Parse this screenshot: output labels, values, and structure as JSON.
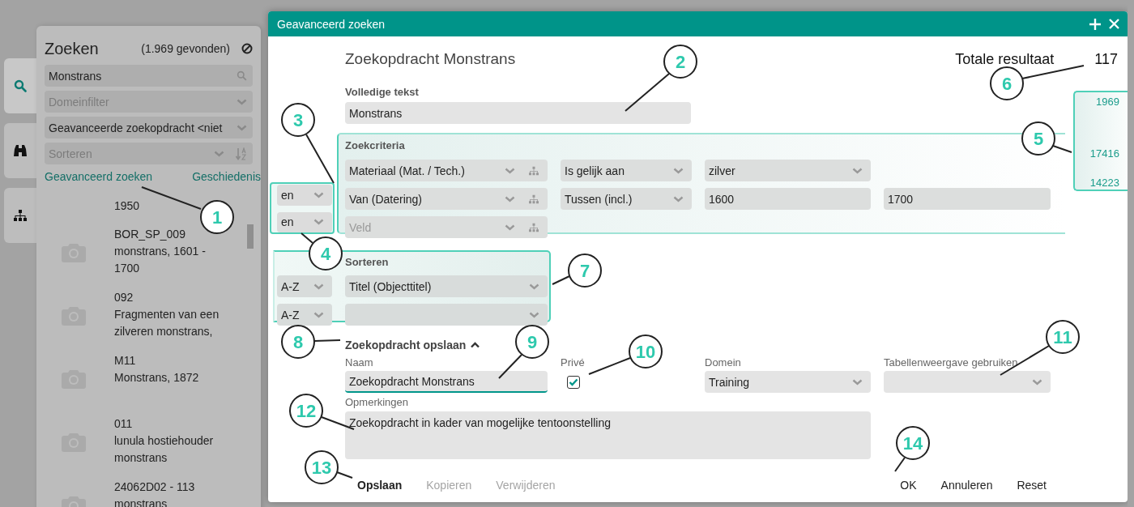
{
  "rail": [
    {
      "kind": "search",
      "selected": true
    },
    {
      "kind": "binoculars",
      "selected": false
    },
    {
      "kind": "hierarchy",
      "selected": false
    }
  ],
  "search_panel": {
    "title": "Zoeken",
    "count": "(1.969 gevonden)",
    "search": {
      "value": "Monstrans"
    },
    "domain_filter": {
      "placeholder": "Domeinfilter"
    },
    "saved_query": {
      "value": "Geavanceerde zoekopdracht <niet"
    },
    "sort": {
      "placeholder": "Sorteren"
    },
    "links": [
      "Geavanceerd zoeken",
      "Geschiedenis"
    ],
    "results": [
      {
        "thumbnail": false,
        "lines": [
          "1950"
        ]
      },
      {
        "thumbnail": true,
        "lines": [
          "BOR_SP_009",
          "monstrans, 1601 -",
          "1700"
        ]
      },
      {
        "thumbnail": true,
        "lines": [
          "092",
          "Fragmenten van een",
          "zilveren monstrans,"
        ]
      },
      {
        "thumbnail": true,
        "lines": [
          "M11",
          "Monstrans, 1872"
        ]
      },
      {
        "thumbnail": true,
        "lines": [
          "011",
          "lunula hostiehouder",
          "monstrans"
        ]
      },
      {
        "thumbnail": true,
        "lines": [
          "24062D02 - 113",
          "monstrans"
        ]
      }
    ]
  },
  "dialog": {
    "title": "Geavanceerd zoeken",
    "query_name": "Zoekopdracht Monstrans",
    "total_label": "Totale resultaat",
    "total": "117",
    "fulltext": {
      "label": "Volledige tekst",
      "value": "Monstrans"
    },
    "criteria": {
      "label": "Zoekcriteria",
      "rows": [
        {
          "field": {
            "value": "Materiaal (Mat. / Tech.)"
          },
          "operator": "Is gelijk aan",
          "values": [
            {
              "kind": "select",
              "text": "zilver"
            }
          ]
        },
        {
          "connector": "en",
          "field": {
            "value": "Van (Datering)"
          },
          "operator": "Tussen (incl.)",
          "values": [
            {
              "kind": "text",
              "text": "1600"
            },
            {
              "kind": "text",
              "text": "1700"
            }
          ]
        },
        {
          "connector": "en",
          "field": {
            "placeholder": "Veld"
          }
        }
      ]
    },
    "counts": [
      "1969",
      "17416",
      "14223"
    ],
    "sort": {
      "label": "Sorteren",
      "rows": [
        {
          "direction": "A-Z",
          "field": "Titel (Objecttitel)"
        },
        {
          "direction": "A-Z"
        }
      ]
    },
    "save": {
      "label": "Zoekopdracht opslaan",
      "expanded": true,
      "name_label": "Naam",
      "name": "Zoekopdracht Monstrans",
      "private_label": "Privé",
      "private": true,
      "domain_label": "Domein",
      "domain": "Training",
      "table_view_label": "Tabellenweergave gebruiken",
      "remarks_label": "Opmerkingen",
      "remarks": "Zoekopdracht in kader van mogelijke tentoonstelling"
    },
    "left_actions": [
      {
        "label": "Opslaan",
        "disabled": false
      },
      {
        "label": "Kopieren",
        "disabled": true
      },
      {
        "label": "Verwijderen",
        "disabled": true
      }
    ],
    "right_actions": [
      {
        "label": "OK",
        "disabled": false
      },
      {
        "label": "Annuleren",
        "disabled": false
      },
      {
        "label": "Reset",
        "disabled": false
      }
    ]
  },
  "callouts": [
    "1",
    "2",
    "3",
    "4",
    "5",
    "6",
    "7",
    "8",
    "9",
    "10",
    "11",
    "12",
    "13",
    "14"
  ]
}
